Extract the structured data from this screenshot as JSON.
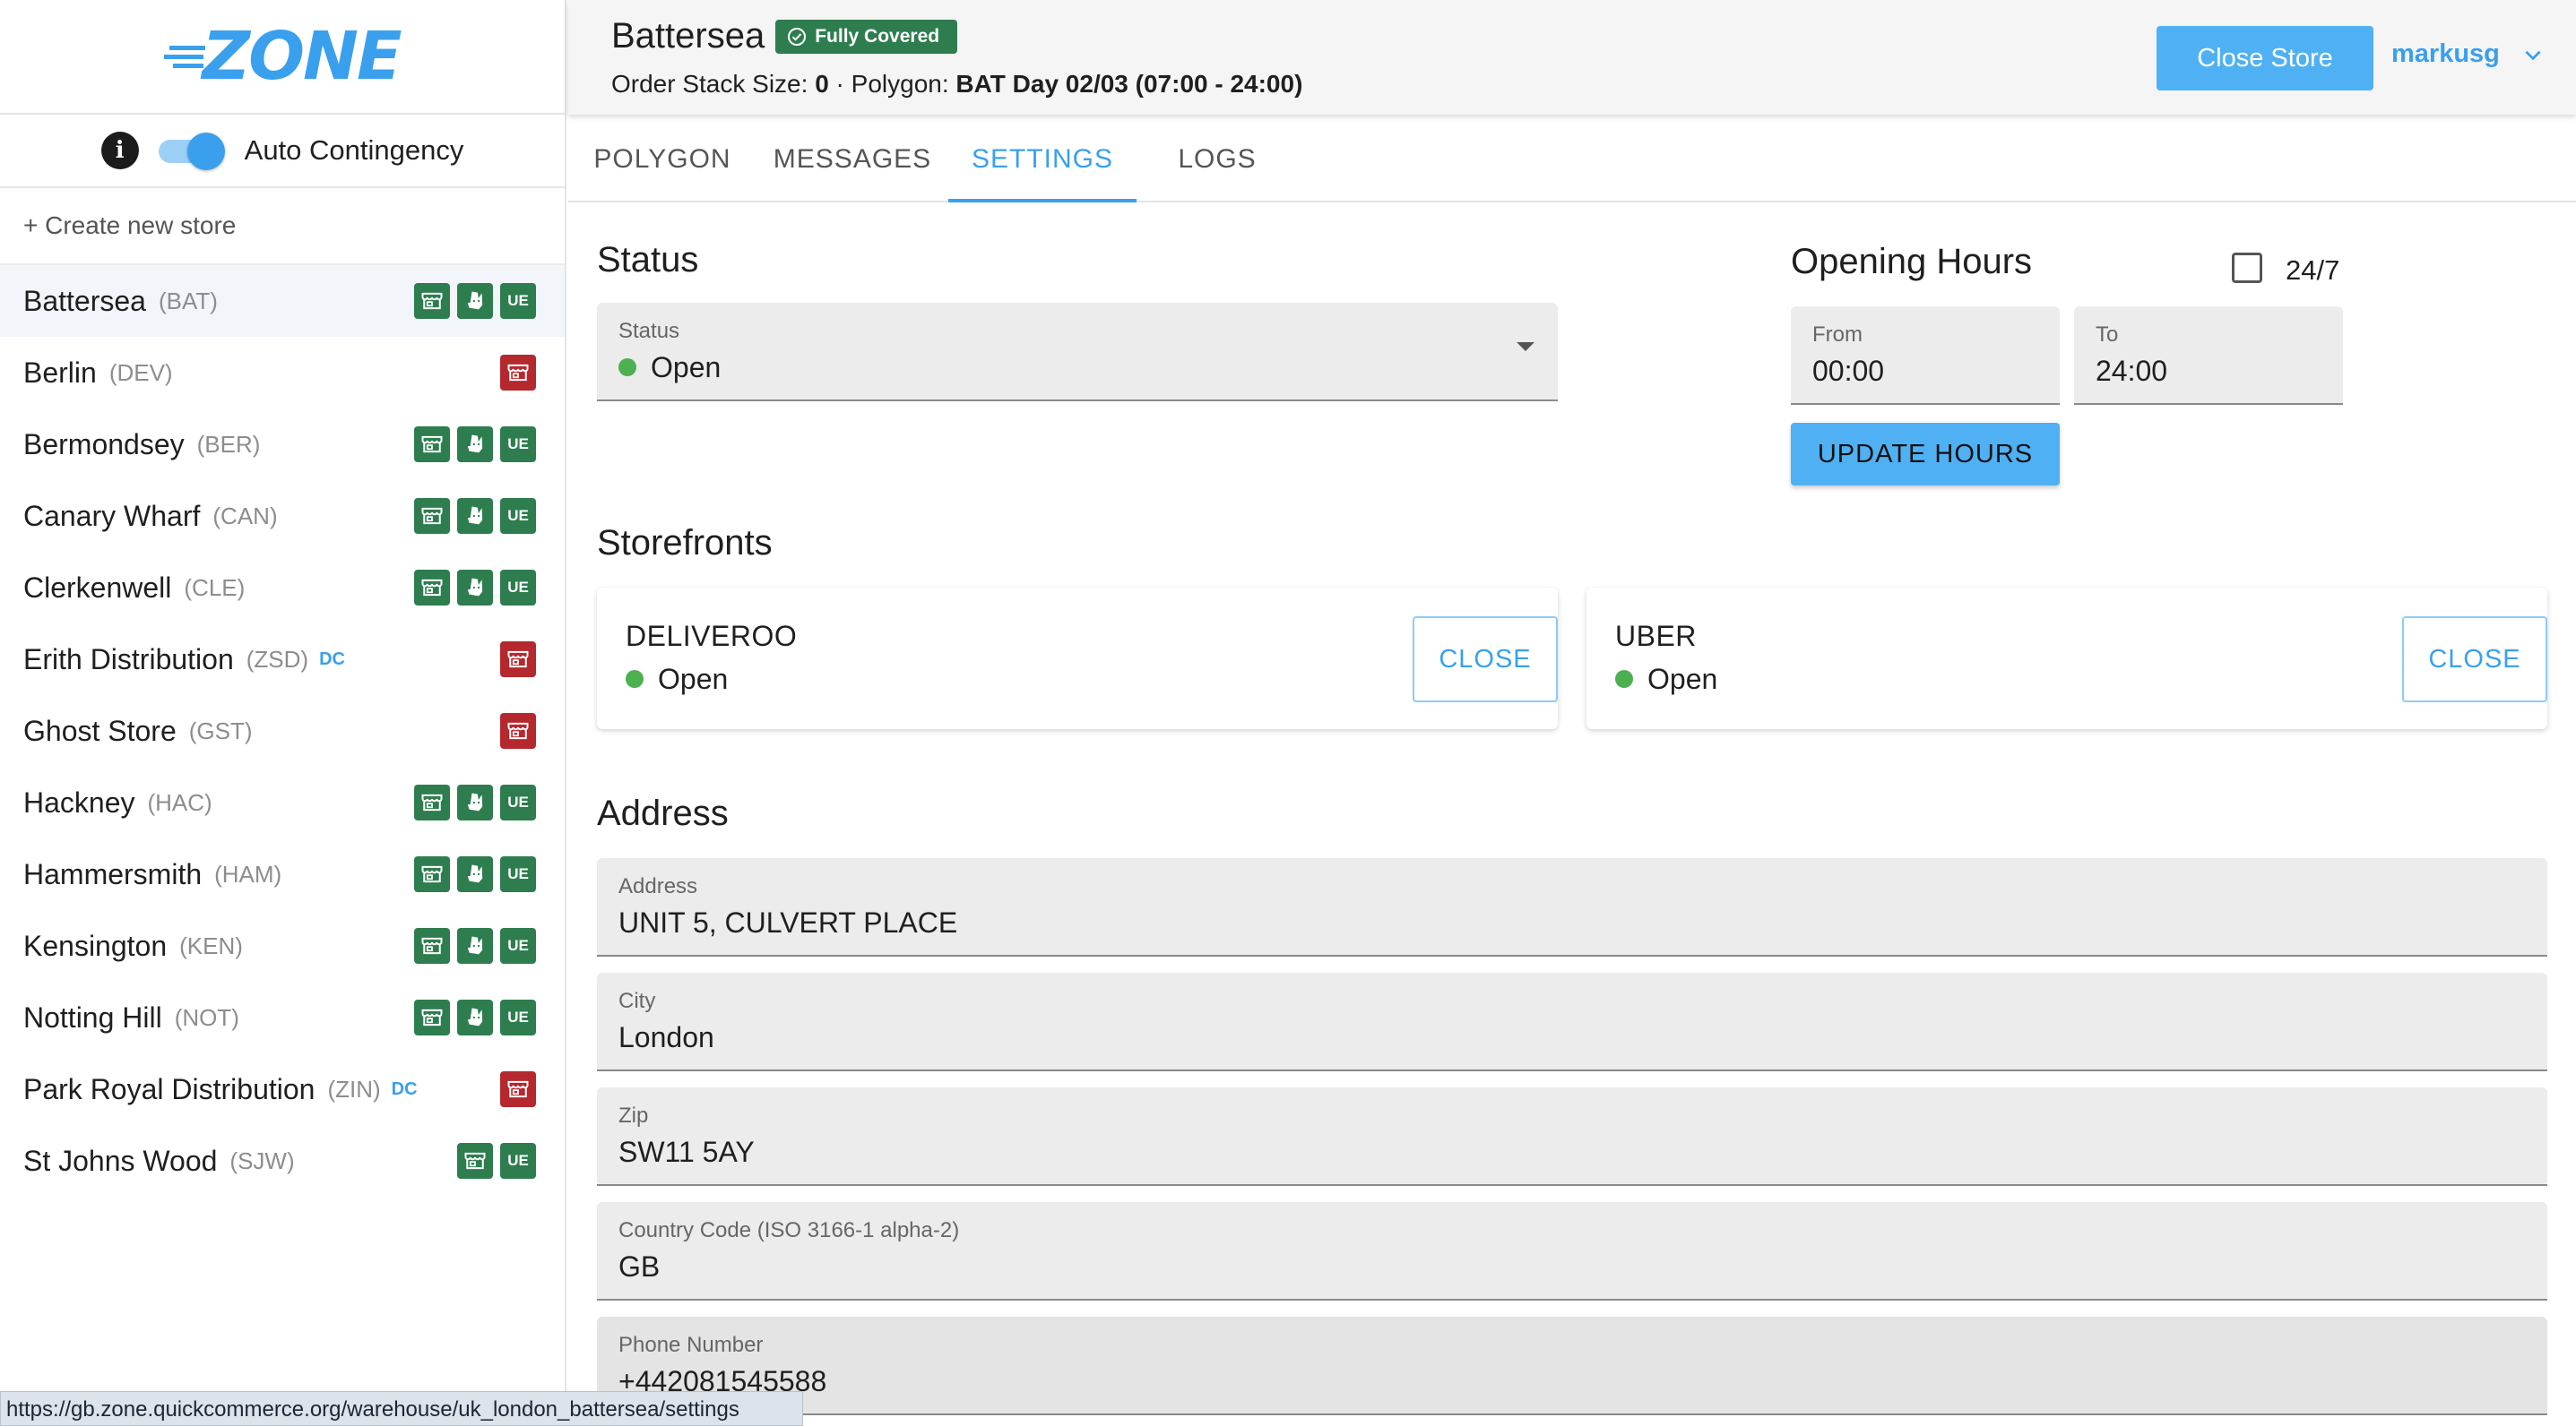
{
  "app": {
    "logo_text": "ZONE"
  },
  "sidebar": {
    "contingency_label": "Auto Contingency",
    "contingency_on": true,
    "create_store_label": "+ Create new store",
    "stores": [
      {
        "name": "Battersea",
        "code": "(BAT)",
        "dc": "",
        "badges": [
          "store",
          "deliveroo",
          "ue"
        ],
        "active": true
      },
      {
        "name": "Berlin",
        "code": "(DEV)",
        "dc": "",
        "badges": [
          "store-red"
        ]
      },
      {
        "name": "Bermondsey",
        "code": "(BER)",
        "dc": "",
        "badges": [
          "store",
          "deliveroo",
          "ue"
        ]
      },
      {
        "name": "Canary Wharf",
        "code": "(CAN)",
        "dc": "",
        "badges": [
          "store",
          "deliveroo",
          "ue"
        ]
      },
      {
        "name": "Clerkenwell",
        "code": "(CLE)",
        "dc": "",
        "badges": [
          "store",
          "deliveroo",
          "ue"
        ]
      },
      {
        "name": "Erith Distribution",
        "code": "(ZSD)",
        "dc": "DC",
        "badges": [
          "store-red"
        ]
      },
      {
        "name": "Ghost Store",
        "code": "(GST)",
        "dc": "",
        "badges": [
          "store-red"
        ]
      },
      {
        "name": "Hackney",
        "code": "(HAC)",
        "dc": "",
        "badges": [
          "store",
          "deliveroo",
          "ue"
        ]
      },
      {
        "name": "Hammersmith",
        "code": "(HAM)",
        "dc": "",
        "badges": [
          "store",
          "deliveroo",
          "ue"
        ]
      },
      {
        "name": "Kensington",
        "code": "(KEN)",
        "dc": "",
        "badges": [
          "store",
          "deliveroo",
          "ue"
        ]
      },
      {
        "name": "Notting Hill",
        "code": "(NOT)",
        "dc": "",
        "badges": [
          "store",
          "deliveroo",
          "ue"
        ]
      },
      {
        "name": "Park Royal Distribution",
        "code": "(ZIN)",
        "dc": "DC",
        "badges": [
          "store-red"
        ]
      },
      {
        "name": "St Johns Wood",
        "code": "(SJW)",
        "dc": "",
        "badges": [
          "store",
          "ue"
        ]
      }
    ],
    "ue_badge_text": "UE"
  },
  "header": {
    "store_title": "Battersea",
    "coverage_chip": "Fully Covered",
    "stack_label": "Order Stack Size:",
    "stack_value": "0",
    "separator": " · ",
    "polygon_label": "Polygon:",
    "polygon_value": "BAT Day 02/03 (07:00 - 24:00)",
    "close_store_label": "Close Store",
    "user_name": "markusg"
  },
  "tabs": [
    {
      "label": "POLYGON",
      "active": false
    },
    {
      "label": "MESSAGES",
      "active": false
    },
    {
      "label": "SETTINGS",
      "active": true
    },
    {
      "label": "LOGS",
      "active": false
    }
  ],
  "status": {
    "section_title": "Status",
    "field_label": "Status",
    "value": "Open"
  },
  "opening_hours": {
    "section_title": "Opening Hours",
    "twentyfour_seven_label": "24/7",
    "twentyfour_seven_checked": false,
    "from_label": "From",
    "from_value": "00:00",
    "to_label": "To",
    "to_value": "24:00",
    "update_label": "UPDATE HOURS"
  },
  "storefronts": {
    "section_title": "Storefronts",
    "items": [
      {
        "name": "DELIVEROO",
        "status": "Open",
        "action": "CLOSE"
      },
      {
        "name": "UBER",
        "status": "Open",
        "action": "CLOSE"
      }
    ]
  },
  "address": {
    "section_title": "Address",
    "fields": [
      {
        "label": "Address",
        "value": "UNIT 5, CULVERT PLACE"
      },
      {
        "label": "City",
        "value": "London"
      },
      {
        "label": "Zip",
        "value": "SW11 5AY"
      },
      {
        "label": "Country Code (ISO 3166-1 alpha-2)",
        "value": "GB"
      },
      {
        "label": "Phone Number",
        "value": "+442081545588"
      }
    ]
  },
  "status_bar": {
    "url": "https://gb.zone.quickcommerce.org/warehouse/uk_london_battersea/settings"
  },
  "colors": {
    "accent": "#3aa0ee",
    "button_fill": "#4fb1f4",
    "badge_green": "#2e7d4f",
    "badge_red": "#b4282e",
    "status_open": "#4caf50"
  }
}
